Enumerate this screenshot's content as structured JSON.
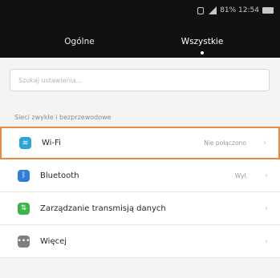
{
  "status_bar": {
    "text": "81% 12:54"
  },
  "tabs": [
    {
      "label": "Ogólne"
    },
    {
      "label": "Wszystkie"
    }
  ],
  "search": {
    "placeholder": "Szukaj ustawienia..."
  },
  "section": {
    "title": "Sieci zwykłe i bezprzewodowe"
  },
  "rows": [
    {
      "label": "Wi-Fi",
      "value": "Nie połączono",
      "icon": "wifi-icon",
      "color": "#2fa3d6"
    },
    {
      "label": "Bluetooth",
      "value": "Wył.",
      "icon": "bluetooth-icon",
      "color": "#2f7fd8"
    },
    {
      "label": "Zarządzanie transmisją danych",
      "value": "",
      "icon": "data-transfer-icon",
      "color": "#39b54a"
    },
    {
      "label": "Więcej",
      "value": "",
      "icon": "more-icon",
      "color": "#7e7e7e"
    }
  ],
  "colors": {
    "header_bg": "#111111",
    "highlight_border": "#e98a3f",
    "page_bg": "#f4f4f4"
  }
}
